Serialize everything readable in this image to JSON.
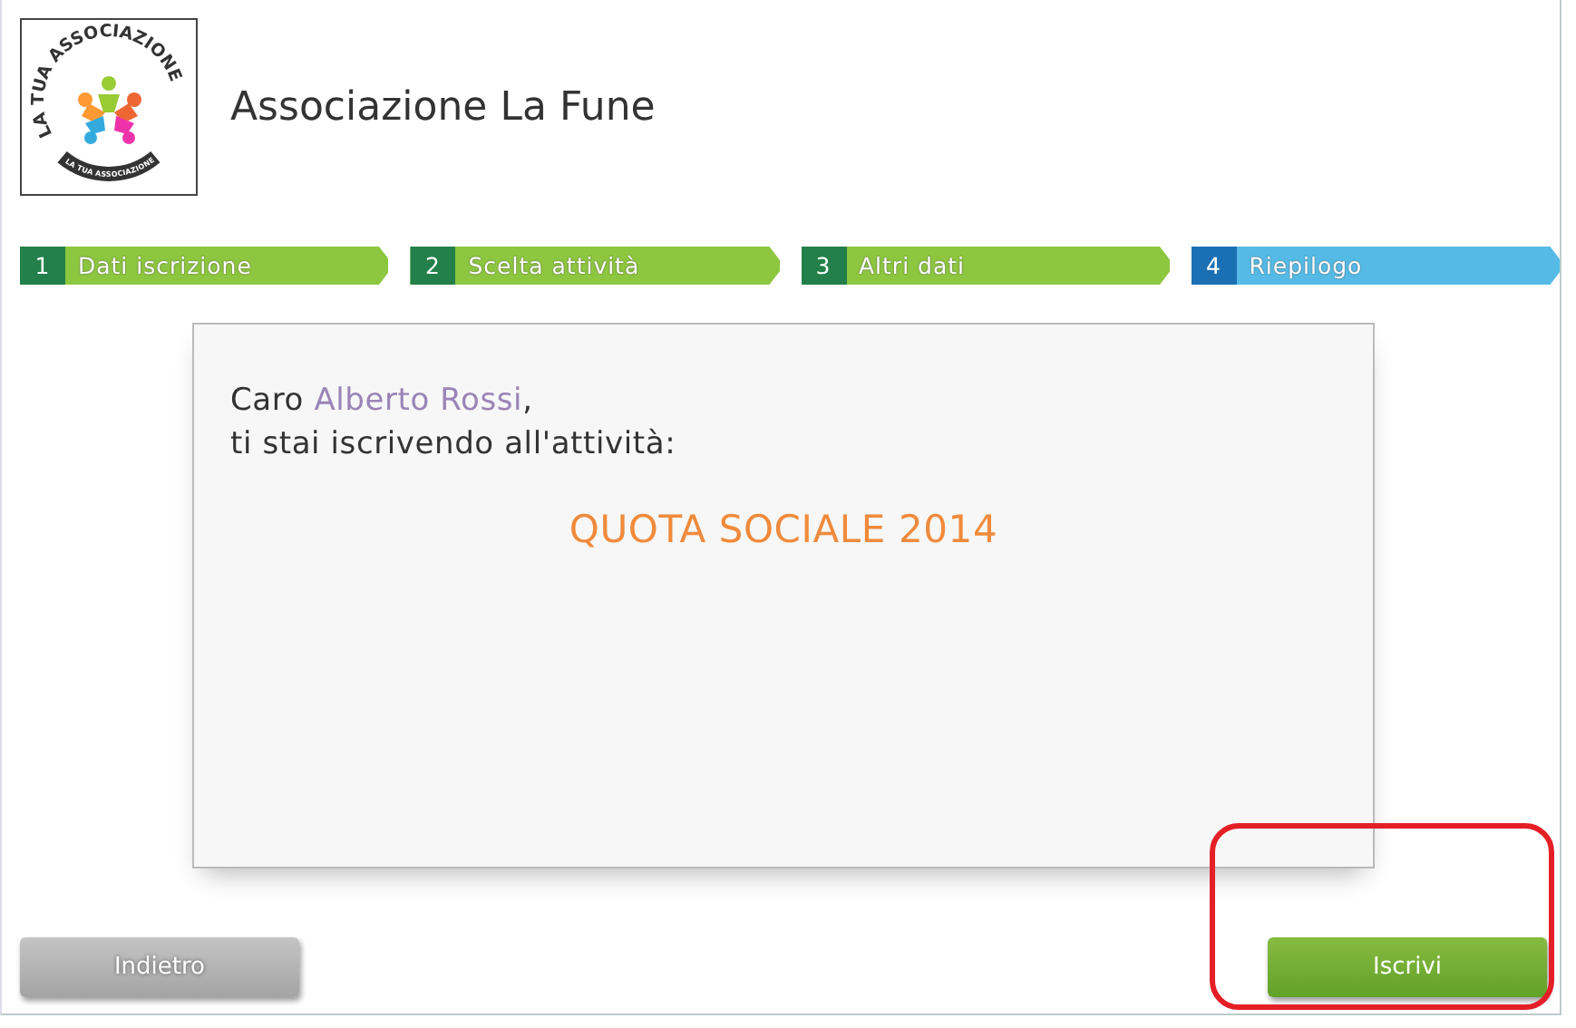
{
  "header": {
    "logo": {
      "ring_text": "LA TUA ASSOCIAZIONE",
      "band_text": "LA TUA ASSOCIAZIONE"
    },
    "title": "Associazione La Fune"
  },
  "steps": [
    {
      "number": "1",
      "label": "Dati iscrizione",
      "selected": false
    },
    {
      "number": "2",
      "label": "Scelta attività",
      "selected": false
    },
    {
      "number": "3",
      "label": "Altri dati",
      "selected": false
    },
    {
      "number": "4",
      "label": "Riepilogo",
      "selected": true
    }
  ],
  "summary": {
    "greeting": "Caro",
    "name": "Alberto Rossi",
    "punct": ",",
    "line2": "ti stai iscrivendo all'attività:",
    "activity": "QUOTA SOCIALE 2014"
  },
  "buttons": [
    {
      "label": "Indietro",
      "kind": "back"
    },
    {
      "label": "Iscrivi",
      "kind": "submit",
      "highlighted": true
    }
  ]
}
